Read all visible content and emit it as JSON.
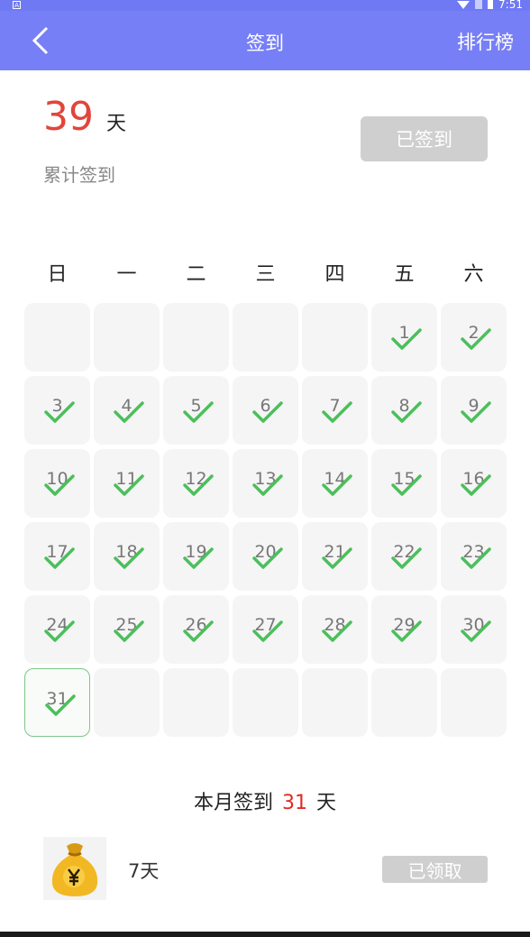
{
  "status_bar": {
    "badge": "A",
    "time": "7:51"
  },
  "header": {
    "title": "签到",
    "action": "排行榜"
  },
  "summary": {
    "total": "39",
    "unit": "天",
    "label": "累计签到",
    "button": "已签到"
  },
  "weekdays": [
    "日",
    "一",
    "二",
    "三",
    "四",
    "五",
    "六"
  ],
  "calendar": {
    "days": [
      "",
      "",
      "",
      "",
      "",
      "1",
      "2",
      "3",
      "4",
      "5",
      "6",
      "7",
      "8",
      "9",
      "10",
      "11",
      "12",
      "13",
      "14",
      "15",
      "16",
      "17",
      "18",
      "19",
      "20",
      "21",
      "22",
      "23",
      "24",
      "25",
      "26",
      "27",
      "28",
      "29",
      "30",
      "31",
      "",
      "",
      "",
      "",
      "",
      ""
    ],
    "signed_through": 31,
    "today": "31"
  },
  "month": {
    "prefix": "本月签到",
    "count": "31",
    "unit": "天"
  },
  "reward": {
    "label": "7天",
    "button": "已领取",
    "icon": "money-bag-icon"
  },
  "colors": {
    "accent": "#777ff6",
    "check": "#4bbf5c",
    "highlight": "#e02b24"
  }
}
